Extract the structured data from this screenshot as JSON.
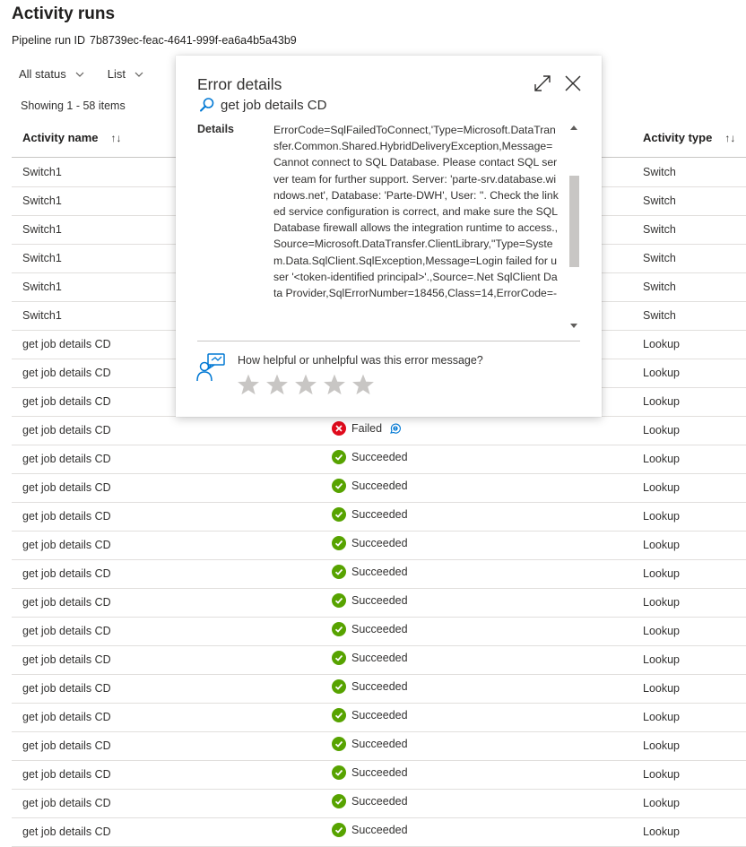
{
  "page": {
    "title": "Activity runs",
    "pipeline_run_id_label": "Pipeline run ID",
    "pipeline_run_id": "7b8739ec-feac-4641-999f-ea6a4b5a43b9"
  },
  "toolbar": {
    "status_filter": "All status",
    "view_mode": "List"
  },
  "list": {
    "showing": "Showing 1 - 58 items",
    "columns": {
      "activity_name": "Activity name",
      "activity_type": "Activity type"
    },
    "rows": [
      {
        "name": "Switch1",
        "status": "",
        "type": "Switch"
      },
      {
        "name": "Switch1",
        "status": "",
        "type": "Switch"
      },
      {
        "name": "Switch1",
        "status": "",
        "type": "Switch"
      },
      {
        "name": "Switch1",
        "status": "",
        "type": "Switch"
      },
      {
        "name": "Switch1",
        "status": "",
        "type": "Switch"
      },
      {
        "name": "Switch1",
        "status": "",
        "type": "Switch"
      },
      {
        "name": "get job details CD",
        "status": "",
        "type": "Lookup"
      },
      {
        "name": "get job details CD",
        "status": "",
        "type": "Lookup"
      },
      {
        "name": "get job details CD",
        "status": "",
        "type": "Lookup"
      },
      {
        "name": "get job details CD",
        "status": "Failed",
        "type": "Lookup"
      },
      {
        "name": "get job details CD",
        "status": "Succeeded",
        "type": "Lookup"
      },
      {
        "name": "get job details CD",
        "status": "Succeeded",
        "type": "Lookup"
      },
      {
        "name": "get job details CD",
        "status": "Succeeded",
        "type": "Lookup"
      },
      {
        "name": "get job details CD",
        "status": "Succeeded",
        "type": "Lookup"
      },
      {
        "name": "get job details CD",
        "status": "Succeeded",
        "type": "Lookup"
      },
      {
        "name": "get job details CD",
        "status": "Succeeded",
        "type": "Lookup"
      },
      {
        "name": "get job details CD",
        "status": "Succeeded",
        "type": "Lookup"
      },
      {
        "name": "get job details CD",
        "status": "Succeeded",
        "type": "Lookup"
      },
      {
        "name": "get job details CD",
        "status": "Succeeded",
        "type": "Lookup"
      },
      {
        "name": "get job details CD",
        "status": "Succeeded",
        "type": "Lookup"
      },
      {
        "name": "get job details CD",
        "status": "Succeeded",
        "type": "Lookup"
      },
      {
        "name": "get job details CD",
        "status": "Succeeded",
        "type": "Lookup"
      },
      {
        "name": "get job details CD",
        "status": "Succeeded",
        "type": "Lookup"
      },
      {
        "name": "get job details CD",
        "status": "Succeeded",
        "type": "Lookup"
      }
    ]
  },
  "error_panel": {
    "title": "Error details",
    "activity_name": "get job details CD",
    "details_label": "Details",
    "details_text": "ErrorCode=SqlFailedToConnect,'Type=Microsoft.DataTransfer.Common.Shared.HybridDeliveryException,Message=Cannot connect to SQL Database. Please contact SQL server team for further support. Server: 'parte-srv.database.windows.net', Database: 'Parte-DWH', User: ''. Check the linked service configuration is correct, and make sure the SQL Database firewall allows the integration runtime to access.,Source=Microsoft.DataTransfer.ClientLibrary,''Type=System.Data.SqlClient.SqlException,Message=Login failed for user '<token-identified principal>'.,Source=.Net SqlClient Data Provider,SqlErrorNumber=18456,Class=14,ErrorCode=-",
    "feedback_question": "How helpful or unhelpful was this error message?",
    "rating_max": 5,
    "rating_value": 0
  },
  "colors": {
    "success": "#57a300",
    "failure": "#e00b1c",
    "accent": "#0078d4",
    "star_empty": "#c8c6c4"
  },
  "icons": {
    "status_filter": "chevron-down-icon",
    "view_mode": "chevron-down-icon",
    "sort": "sort-icon",
    "success": "checkmark-circle-icon",
    "failure": "error-circle-icon",
    "error_info": "chat-info-icon",
    "panel_search": "search-icon",
    "expand": "expand-icon",
    "close": "close-icon",
    "feedback": "feedback-person-icon",
    "star": "star-icon"
  }
}
